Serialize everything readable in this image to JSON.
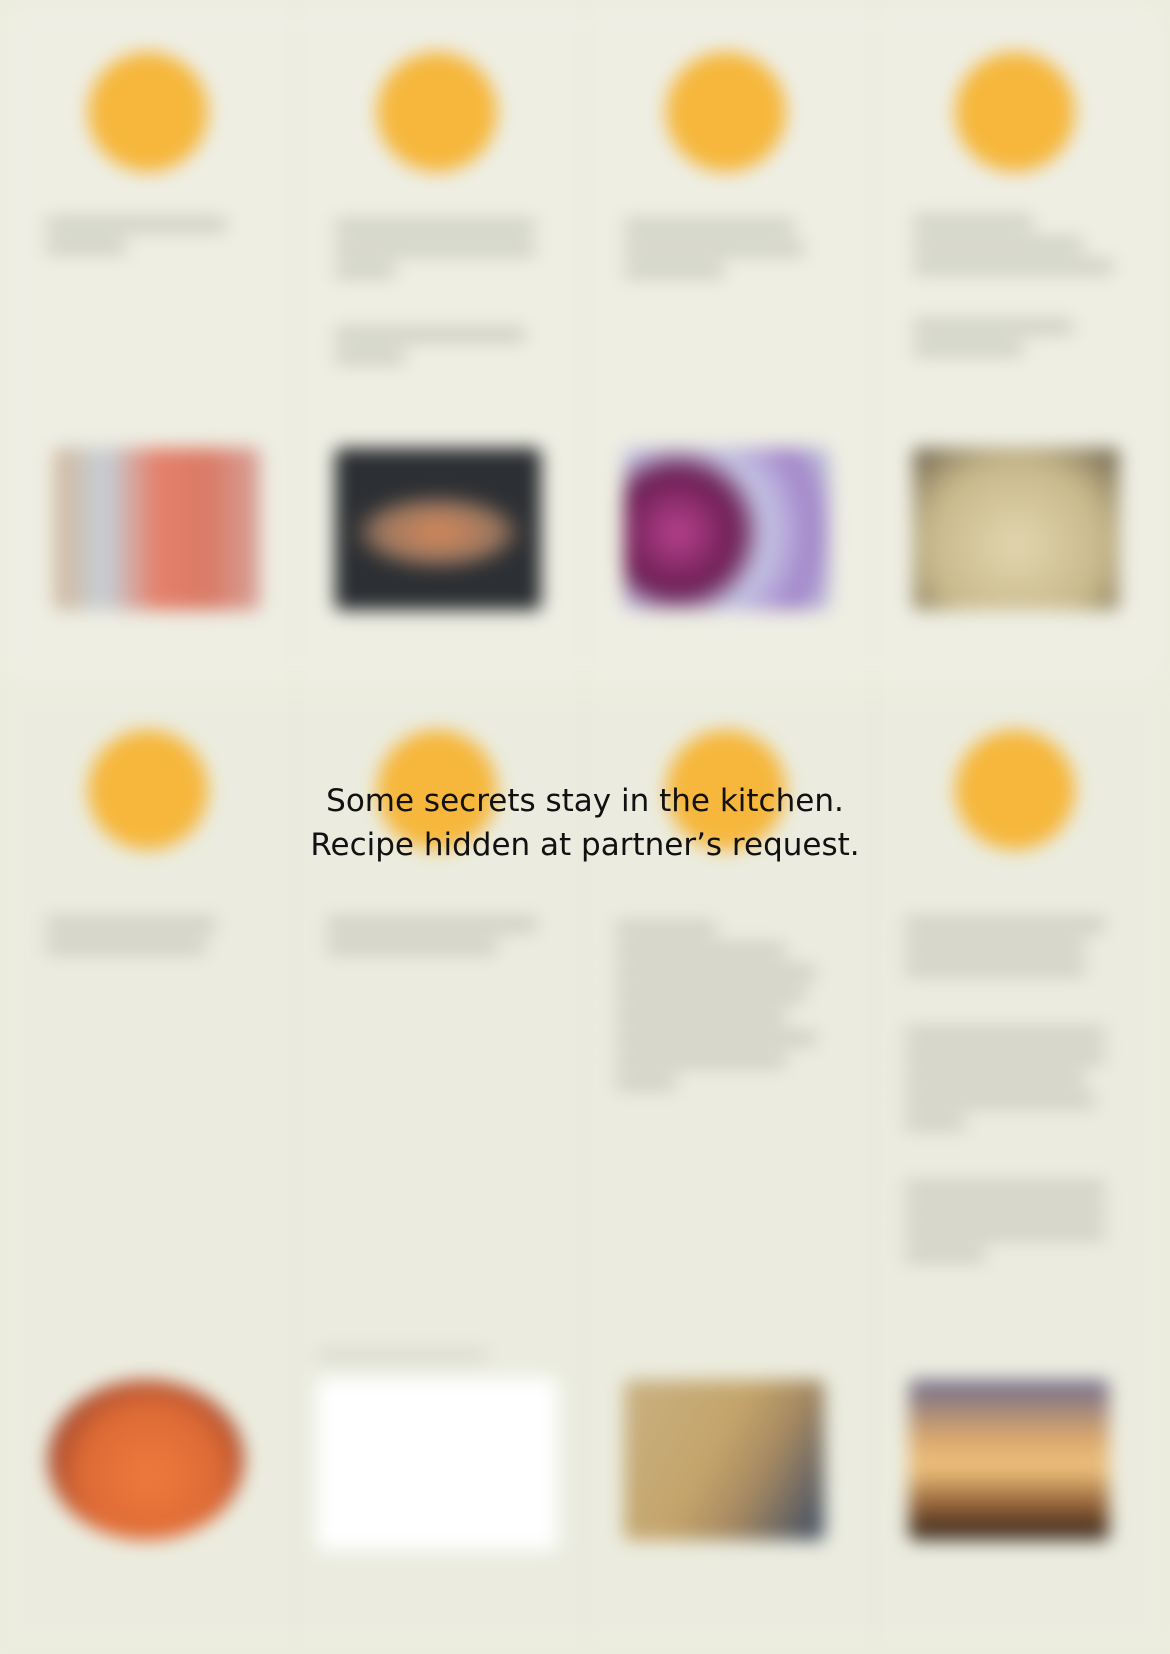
{
  "overlay": {
    "line1": "Some secrets stay in the kitchen.",
    "line2": "Recipe hidden at partner’s request."
  },
  "colors": {
    "page_background": "#ecedde",
    "step_circle": "#f6b73c",
    "message_text": "#111111"
  },
  "steps_top": [
    {
      "photo_icon": "shrimp-plate-photo"
    },
    {
      "photo_icon": "skillet-dumplings-photo"
    },
    {
      "photo_icon": "red-onion-photo"
    },
    {
      "photo_icon": "dough-bowl-photo"
    }
  ],
  "steps_bottom": [
    {
      "photo_icon": "tomato-sauce-photo"
    },
    {
      "photo_icon": "blank-photo"
    },
    {
      "photo_icon": "folding-dough-photo"
    },
    {
      "photo_icon": "baked-dish-photo"
    }
  ]
}
